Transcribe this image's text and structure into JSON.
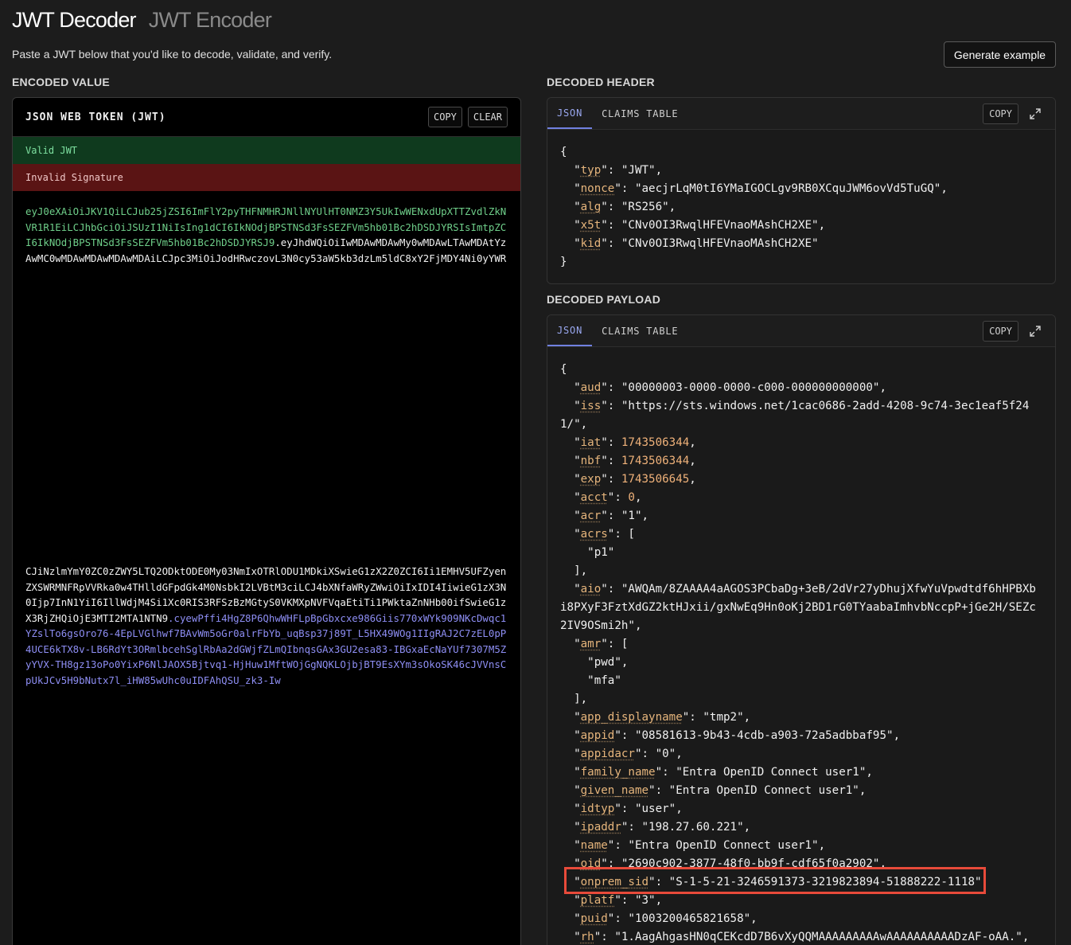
{
  "tabs": {
    "decoder": "JWT Decoder",
    "encoder": "JWT Encoder"
  },
  "subtitle": "Paste a JWT below that you'd like to decode, validate, and verify.",
  "generate_button": "Generate example",
  "labels": {
    "encoded": "ENCODED VALUE",
    "header": "DECODED HEADER",
    "payload": "DECODED PAYLOAD"
  },
  "encoded_panel": {
    "title": "JSON WEB TOKEN (JWT)",
    "copy": "COPY",
    "clear": "CLEAR",
    "status_valid": "Valid JWT",
    "status_invalid": "Invalid Signature",
    "token_part1_green": "eyJ0eXAiOiJKV1QiLCJub25jZSI6ImFlY2pyTHFNMHRJNllNYUlHT0NMZ3Y5UkIwWENxdUpXTTZvdlZkNVR1R1EiLCJhbGciOiJSUzI1NiIsIng1dCI6IkNOdjBPSTNSd3FsSEZFVm5hb01Bc2hDSDJYRSIsImtpZCI6IkNOdjBPSTNSd3FsSEZFVm5hb01Bc2hDSDJYRSJ9",
    "token_part2_white_a": ".eyJhdWQiOiIwMDAwMDAwMy0wMDAwLTAwMDAtYzAwMC0wMDAwMDAwMDAwMDAiLCJpc3MiOiJodHRwczovL3N0cy53aW5kb3dzLm5ldC8xY2FjMDY4Ni0yYWRkLTQyMDgtOWM3NC0zZWMxZWFmNWYyNDEvIiwiaWF0IjoxNzQzNTA2MzQ0LCJuYmYiOjE3NDM1MDYzNDQsImV4cCI6MTc0MzUwNjY0NSwiYWNjdCI6MCwiYWNyIjoiMSIsImFjcnMiOlsicDE",
    "token_part2_white_b": "CJiNzlmYmY0ZC0zZWY5LTQ2ODktODE0My03NmIxOTRlODU1MDkiXSwieG1zX2Z0ZCI6Ii1EMHV5UFZyenZXSWRMNFRpVVRka0w4THlldGFpdGk4M0NsbkI2LVBtM3ciLCJ4bXNfaWRyZWwiOiIxIDI4IiwieG1zX3N0Ijp7InN1YiI6IllWdjM4Si1Xc0RIS3RFSzBzMGtyS0VKMXpNVFVqaEtiTi1PWktaZnNHb00ifSwieG1zX3RjZHQiOjE3MTI2MTA1NTN9",
    "token_part3_blue": ".cyewPffi4HgZ8P6QhwWHFLpBpGbxcxe986Giis770xWYk909NKcDwqc1YZslTo6gsOro76-4EpLVGlhwf7BAvWm5oGr0alrFbYb_uqBsp37j89T_L5HX49WOg1IIgRAJ2C7zEL0pP4UCE6kTX8v-LB6RdYt3ORmlbcehSglRbAa2dGWjfZLmQIbnqsGAx3GU2esa83-IBGxaEcNaYUf7307M5ZyYVX-TH8gz13oPo0YixP6NlJAOX5Bjtvq1-HjHuw1MftWOjGgNQKLOjbjBT9EsXYm3sOkoSK46cJVVnsCpUkJCv5H9bNutx7l_iHW85wUhc0uIDFAhQSU_zk3-Iw"
  },
  "header_panel": {
    "tab_json": "JSON",
    "tab_claims": "CLAIMS TABLE",
    "copy": "COPY",
    "open": "{",
    "close": "}",
    "lines": [
      {
        "k": "typ",
        "v": "\"JWT\"",
        "t": "s",
        "c": ","
      },
      {
        "k": "nonce",
        "v": "\"aecjrLqM0tI6YMaIGOCLgv9RB0XCquJWM6ovVd5TuGQ\"",
        "t": "s",
        "c": ","
      },
      {
        "k": "alg",
        "v": "\"RS256\"",
        "t": "s",
        "c": ","
      },
      {
        "k": "x5t",
        "v": "\"CNv0OI3RwqlHFEVnaoMAshCH2XE\"",
        "t": "s",
        "c": ","
      },
      {
        "k": "kid",
        "v": "\"CNv0OI3RwqlHFEVnaoMAshCH2XE\"",
        "t": "s",
        "c": ""
      }
    ]
  },
  "payload_panel": {
    "tab_json": "JSON",
    "tab_claims": "CLAIMS TABLE",
    "copy": "COPY",
    "open": "{",
    "aud_k": "aud",
    "aud_v": "\"00000003-0000-0000-c000-000000000000\"",
    "iss_k": "iss",
    "iss_v1": "\"https://sts.windows.net/1cac0686-2add-4208-9c74-3ec1eaf5f24",
    "iss_v2": "1/\"",
    "iat_k": "iat",
    "iat_v": "1743506344",
    "nbf_k": "nbf",
    "nbf_v": "1743506344",
    "exp_k": "exp",
    "exp_v": "1743506645",
    "acct_k": "acct",
    "acct_v": "0",
    "acr_k": "acr",
    "acr_v": "\"1\"",
    "acrs_k": "acrs",
    "acrs_item": "\"p1\"",
    "aio_k": "aio",
    "aio_v1": "\"AWQAm/8ZAAAA4aAGOS3PCbaDg+3eB/2dVr27yDhujXfwYuVpwdtdf6hHPBXb",
    "aio_v2": "i8PXyF3FztXdGZ2ktHJxii/gxNwEq9Hn0oKj2BD1rG0TYaabaImhvbNccpP+jGe2H/SEZc",
    "aio_v3": "2IV9OSmi2h\"",
    "amr_k": "amr",
    "amr_item1": "\"pwd\"",
    "amr_item2": "\"mfa\"",
    "rest": [
      {
        "k": "app_displayname",
        "v": "\"tmp2\""
      },
      {
        "k": "appid",
        "v": "\"08581613-9b43-4cdb-a903-72a5adbbaf95\""
      },
      {
        "k": "appidacr",
        "v": "\"0\""
      },
      {
        "k": "family_name",
        "v": "\"Entra OpenID Connect user1\""
      },
      {
        "k": "given_name",
        "v": "\"Entra OpenID Connect user1\""
      },
      {
        "k": "idtyp",
        "v": "\"user\""
      },
      {
        "k": "ipaddr",
        "v": "\"198.27.60.221\""
      },
      {
        "k": "name",
        "v": "\"Entra OpenID Connect user1\""
      },
      {
        "k": "oid",
        "v": "\"2690c902-3877-48f0-bb9f-cdf65f0a2902\""
      },
      {
        "k": "onprem_sid",
        "v": "\"S-1-5-21-3246591373-3219823894-51888222-1118\""
      },
      {
        "k": "platf",
        "v": "\"3\""
      },
      {
        "k": "puid",
        "v": "\"1003200465821658\""
      },
      {
        "k": "rh",
        "v": "\"1.AagAhgasHN0qCEKcdD7B6vXyQQMAAAAAAAAAwAAAAAAAAAADzAF-oAA.\""
      }
    ]
  }
}
